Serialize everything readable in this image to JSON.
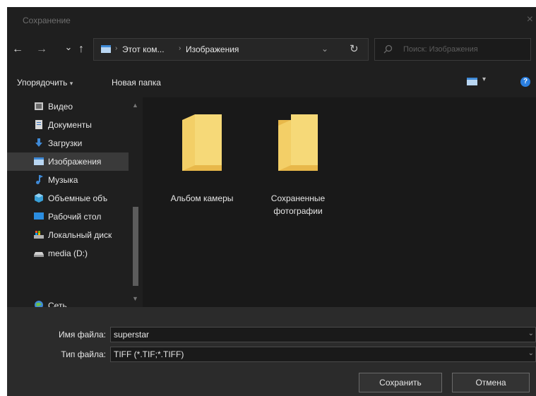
{
  "window": {
    "title": "Сохранение",
    "close_symbol": "×"
  },
  "nav": {
    "back": "←",
    "forward": "→",
    "recent": "⌄",
    "up": "↑"
  },
  "address": {
    "crumbs": [
      "Этот ком...",
      "Изображения"
    ],
    "separator": "›",
    "dropdown": "⌄",
    "refresh": "↻"
  },
  "search": {
    "placeholder": "Поиск: Изображения"
  },
  "toolbar": {
    "organize": "Упорядочить",
    "organize_arrow": "▾",
    "new_folder": "Новая папка",
    "view_arrow": "▾",
    "help": "?"
  },
  "sidebar": {
    "items": [
      {
        "label": "Видео",
        "icon": "video-icon",
        "selected": false
      },
      {
        "label": "Документы",
        "icon": "documents-icon",
        "selected": false
      },
      {
        "label": "Загрузки",
        "icon": "downloads-icon",
        "selected": false
      },
      {
        "label": "Изображения",
        "icon": "pictures-icon",
        "selected": true
      },
      {
        "label": "Музыка",
        "icon": "music-icon",
        "selected": false
      },
      {
        "label": "Объемные объ",
        "icon": "3d-objects-icon",
        "selected": false
      },
      {
        "label": "Рабочий стол",
        "icon": "desktop-icon",
        "selected": false
      },
      {
        "label": "Локальный диск",
        "icon": "local-disk-icon",
        "selected": false
      },
      {
        "label": "media (D:)",
        "icon": "drive-icon",
        "selected": false
      },
      {
        "label": "Сеть",
        "icon": "network-icon",
        "selected": false
      }
    ]
  },
  "folders": [
    {
      "line1": "Альбом камеры",
      "line2": ""
    },
    {
      "line1": "Сохраненные",
      "line2": "фотографии"
    }
  ],
  "form": {
    "filename_label": "Имя файла:",
    "filename_value": "superstar",
    "filetype_label": "Тип файла:",
    "filetype_value": "TIFF (*.TIF;*.TIFF)",
    "arrow": "⌄"
  },
  "buttons": {
    "save": "Сохранить",
    "cancel": "Отмена"
  },
  "colors": {
    "background": "#1f1f1f",
    "folder": "#f3cf67",
    "accent": "#2b7fe0"
  }
}
